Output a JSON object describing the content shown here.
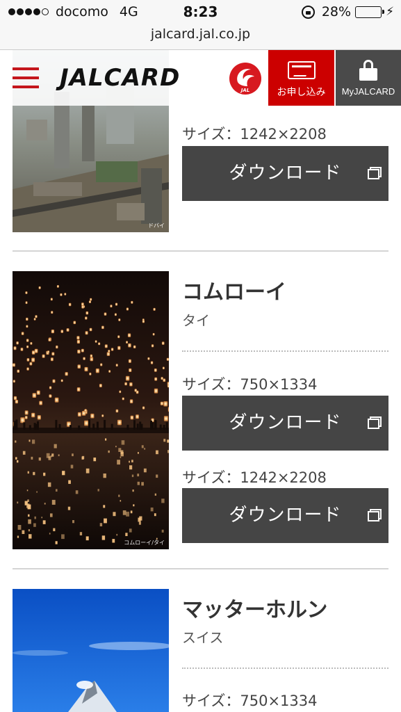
{
  "status_bar": {
    "carrier": "docomo",
    "network": "4G",
    "time": "8:23",
    "battery": "28%",
    "battery_level": 0.28
  },
  "url": "jalcard.jal.co.jp",
  "header": {
    "logo_text": "JALCARD",
    "airline_logo_text": "JAL",
    "apply_label": "お申し込み",
    "mypage_label": "MyJALCARD"
  },
  "items": [
    {
      "size_label": "サイズ：1242×2208",
      "download_label": "ダウンロード",
      "photo_credit": "ドバイ"
    },
    {
      "title": "コムローイ",
      "country": "タイ",
      "photo_credit": "コムローイ/タイ",
      "variants": [
        {
          "size_label": "サイズ：750×1334",
          "download_label": "ダウンロード"
        },
        {
          "size_label": "サイズ：1242×2208",
          "download_label": "ダウンロード"
        }
      ]
    },
    {
      "title": "マッターホルン",
      "country": "スイス",
      "size_label": "サイズ：750×1334"
    }
  ],
  "colors": {
    "brand_red": "#cc0000",
    "button_dark": "#454545",
    "mypage_bg": "#4a4a4a"
  }
}
